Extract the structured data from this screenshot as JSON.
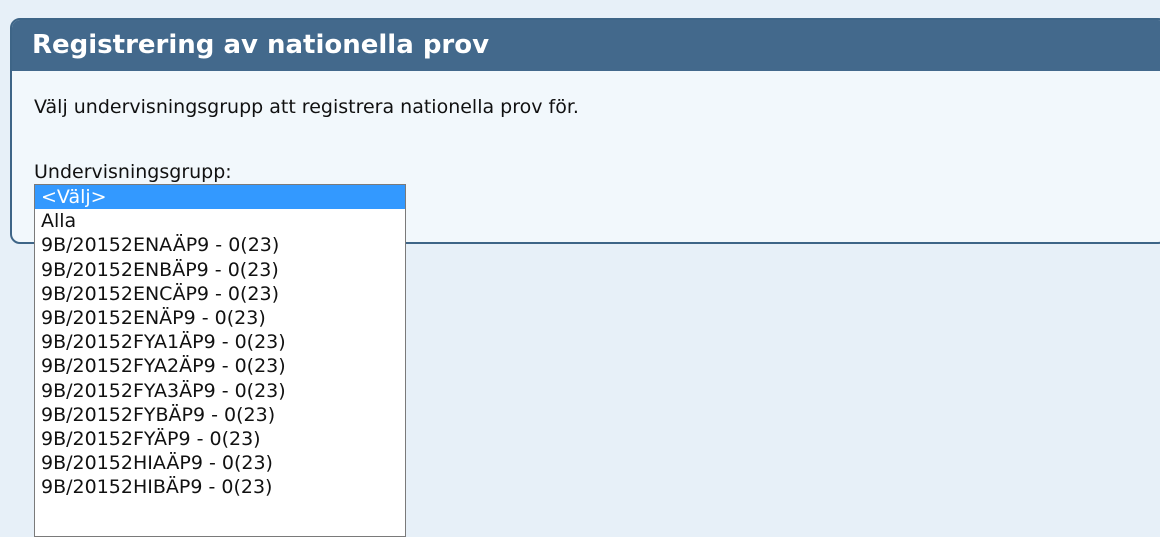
{
  "panel": {
    "title": "Registrering av nationella prov",
    "intro": "Välj undervisningsgrupp att registrera nationella prov för.",
    "group_label": "Undervisningsgrupp:"
  },
  "dropdown": {
    "selected_index": 0,
    "options": [
      "<Välj>",
      "Alla",
      "9B/20152ENAÄP9 - 0(23)",
      "9B/20152ENBÄP9 - 0(23)",
      "9B/20152ENCÄP9 - 0(23)",
      "9B/20152ENÄP9 - 0(23)",
      "9B/20152FYA1ÄP9 - 0(23)",
      "9B/20152FYA2ÄP9 - 0(23)",
      "9B/20152FYA3ÄP9 - 0(23)",
      "9B/20152FYBÄP9 - 0(23)",
      "9B/20152FYÄP9 - 0(23)",
      "9B/20152HIAÄP9 - 0(23)",
      "9B/20152HIBÄP9 - 0(23)"
    ]
  },
  "colors": {
    "header_bg": "#43698c",
    "selected_bg": "#3399ff",
    "page_bg": "#e7f0f8"
  }
}
